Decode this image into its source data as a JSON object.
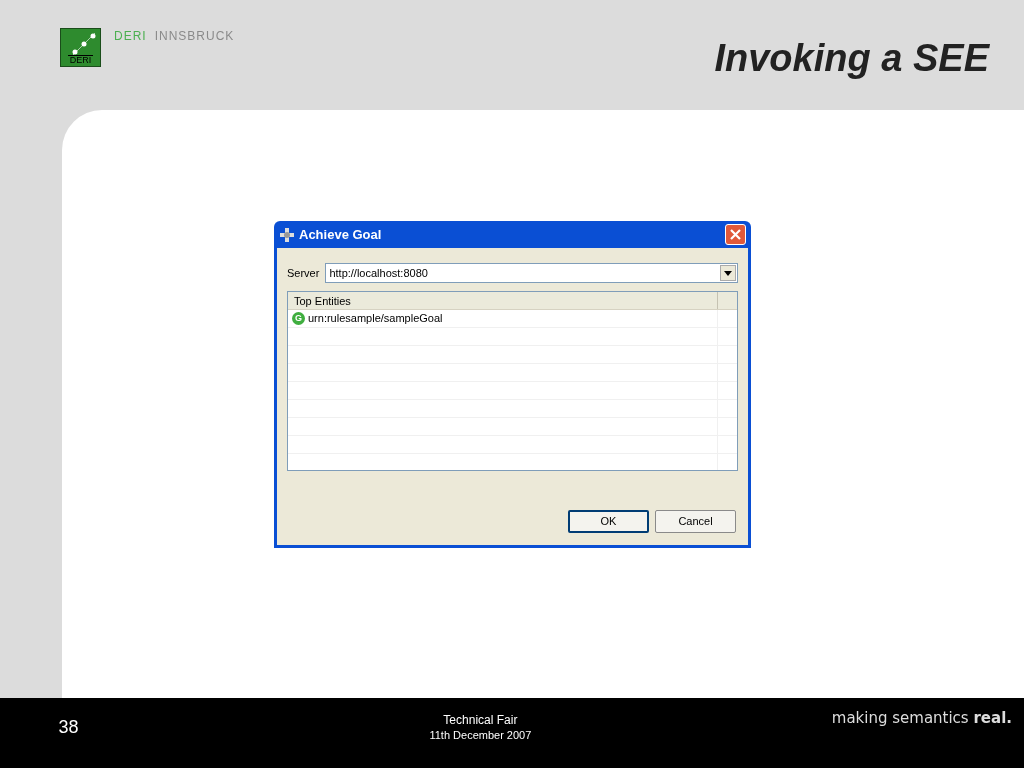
{
  "header": {
    "logo_text": "DERI",
    "brand_primary": "DERI",
    "brand_secondary": "INNSBRUCK",
    "title": "Invoking a SEE"
  },
  "dialog": {
    "title": "Achieve Goal",
    "server_label": "Server",
    "server_value": "http://localhost:8080",
    "table": {
      "columns": [
        "Top Entities"
      ],
      "rows": [
        {
          "icon_letter": "G",
          "text": "urn:rulesample/sampleGoal"
        }
      ]
    },
    "buttons": [
      "OK",
      "Cancel"
    ]
  },
  "footer": {
    "slide_number": "38",
    "event": "Technical Fair",
    "date": "11th December 2007",
    "tagline": "making semantics **real.**"
  }
}
